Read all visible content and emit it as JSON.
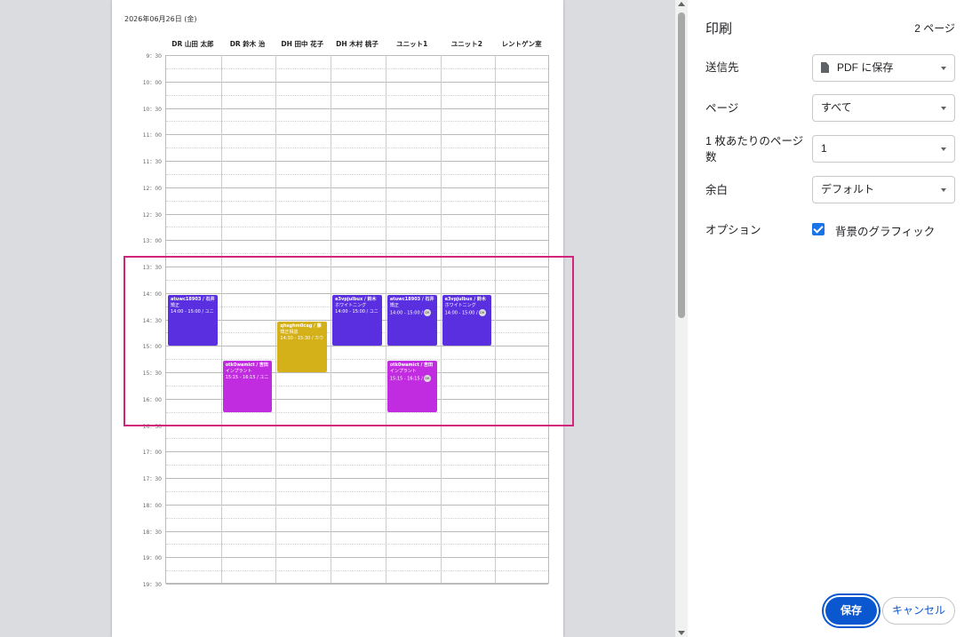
{
  "preview": {
    "date_header": "2026年06月26日 (金)",
    "columns": [
      "DR 山田 太郎",
      "DR 鈴木 治",
      "DH 田中 花子",
      "DH 木村 桃子",
      "ユニット1",
      "ユニット2",
      "レントゲン室"
    ],
    "time_labels": [
      "9：30",
      "10：00",
      "10：30",
      "11：00",
      "11：30",
      "12：00",
      "12：30",
      "13：00",
      "13：30",
      "14：00",
      "14：30",
      "15：00",
      "15：30",
      "16：00",
      "16：30",
      "17：00",
      "17：30",
      "18：00",
      "18：30",
      "19：00",
      "19：30"
    ],
    "appointments": [
      {
        "column": 0,
        "start": "14:00",
        "end": "15:00",
        "color": "#5a2fe0",
        "line1": "atuwc18903 / 石井",
        "line2": "矯正",
        "line3": "14:00 - 15:00 / ユニ",
        "badge": ""
      },
      {
        "column": 1,
        "start": "15:15",
        "end": "16:15",
        "color": "#c22ce0",
        "line1": "otk0wamict / 吉田",
        "line2": "インプラント",
        "line3": "15:15 - 16:15 / ユニ",
        "badge": ""
      },
      {
        "column": 2,
        "start": "14:30",
        "end": "15:30",
        "color": "#d4b019",
        "line1": "qhsghm0cag / 藤",
        "line2": "矯正相談",
        "line3": "14:30 - 15:30 / カウ",
        "badge": ""
      },
      {
        "column": 3,
        "start": "14:00",
        "end": "15:00",
        "color": "#5a2fe0",
        "line1": "e3vpjulbux / 鈴木",
        "line2": "ホワイトニング",
        "line3": "14:00 - 15:00 / ユニ",
        "badge": ""
      },
      {
        "column": 4,
        "start": "14:00",
        "end": "15:00",
        "color": "#5a2fe0",
        "line1": "atuwc18903 / 石井",
        "line2": "矯正",
        "line3": "14:00 - 15:00 /",
        "badge": "DR"
      },
      {
        "column": 4,
        "start": "15:15",
        "end": "16:15",
        "color": "#c22ce0",
        "line1": "otk0wamict / 吉田",
        "line2": "インプラント",
        "line3": "15:15 - 16:15 /",
        "badge": "DR"
      },
      {
        "column": 5,
        "start": "14:00",
        "end": "15:00",
        "color": "#5a2fe0",
        "line1": "e3vpjulbux / 鈴木",
        "line2": "ホワイトニング",
        "line3": "14:00 - 15:00 /",
        "badge": "DH"
      }
    ]
  },
  "panel": {
    "title": "印刷",
    "page_count": "2 ページ",
    "destination_label": "送信先",
    "destination_value": "PDF に保存",
    "pages_label": "ページ",
    "pages_value": "すべて",
    "pages_per_sheet_label_1": "1 枚あたりのページ",
    "pages_per_sheet_label_2": "数",
    "pages_per_sheet_value": "1",
    "margins_label": "余白",
    "margins_value": "デフォルト",
    "options_label": "オプション",
    "background_graphics_label": "背景のグラフィック",
    "background_graphics_checked": true,
    "save_label": "保存",
    "cancel_label": "キャンセル"
  },
  "colors": {
    "accent": "#0b57d0",
    "highlight": "#d4237a",
    "appt_purple": "#5a2fe0",
    "appt_magenta": "#c22ce0",
    "appt_yellow": "#d4b019"
  }
}
